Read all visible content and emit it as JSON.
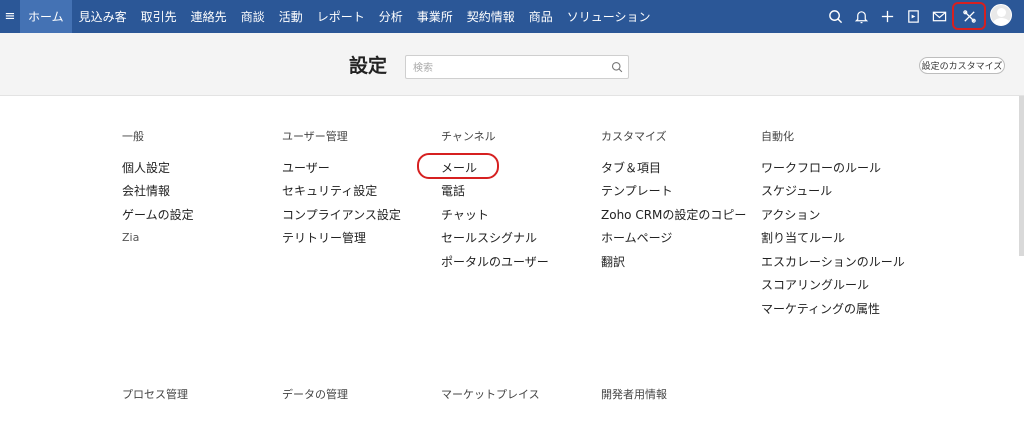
{
  "nav": {
    "menu_icon": "hamburger-icon",
    "tabs": [
      {
        "label": "ホーム",
        "active": true
      },
      {
        "label": "見込み客"
      },
      {
        "label": "取引先"
      },
      {
        "label": "連絡先"
      },
      {
        "label": "商談"
      },
      {
        "label": "活動"
      },
      {
        "label": "レポート"
      },
      {
        "label": "分析"
      },
      {
        "label": "事業所"
      },
      {
        "label": "契約情報"
      },
      {
        "label": "商品"
      },
      {
        "label": "ソリューション"
      }
    ],
    "icons": [
      "search-icon",
      "bell-icon",
      "plus-icon",
      "calendar-icon",
      "mail-icon",
      "setup-icon",
      "avatar"
    ]
  },
  "header": {
    "title": "設定",
    "search_placeholder": "検索",
    "customize_button": "設定のカスタマイズ"
  },
  "columns": [
    {
      "heading": "一般",
      "items": [
        "個人設定",
        "会社情報",
        "ゲームの設定",
        "Zia"
      ]
    },
    {
      "heading": "ユーザー管理",
      "items": [
        "ユーザー",
        "セキュリティ設定",
        "コンプライアンス設定",
        "テリトリー管理"
      ]
    },
    {
      "heading": "チャンネル",
      "items": [
        "メール",
        "電話",
        "チャット",
        "セールスシグナル",
        "ポータルのユーザー"
      ]
    },
    {
      "heading": "カスタマイズ",
      "items": [
        "タブ＆項目",
        "テンプレート",
        "Zoho CRMの設定のコピー",
        "ホームページ",
        "翻訳"
      ]
    },
    {
      "heading": "自動化",
      "items": [
        "ワークフローのルール",
        "スケジュール",
        "アクション",
        "割り当てルール",
        "エスカレーションのルール",
        "スコアリングルール",
        "マーケティングの属性"
      ]
    }
  ],
  "bottom_headings": [
    "プロセス管理",
    "データの管理",
    "マーケットプレイス",
    "開発者用情報"
  ],
  "colors": {
    "nav_bg": "#2b5797",
    "active_tab": "#4472b4",
    "highlight": "#d62020"
  }
}
